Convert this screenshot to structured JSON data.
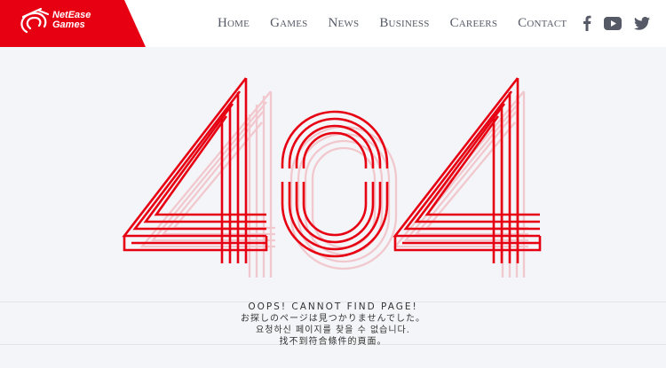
{
  "brand": {
    "name_line1": "NetEase",
    "name_line2": "Games",
    "color": "#e60012"
  },
  "nav": {
    "items": [
      {
        "label": "Home"
      },
      {
        "label": "Games"
      },
      {
        "label": "News"
      },
      {
        "label": "Business"
      },
      {
        "label": "Careers"
      },
      {
        "label": "Contact"
      }
    ]
  },
  "social": {
    "icons": [
      "facebook-icon",
      "youtube-icon",
      "twitter-icon"
    ]
  },
  "error": {
    "code": "404",
    "message_en": "OOPS! CANNOT FIND PAGE!",
    "message_ja": "お探しのページは見つかりませんでした。",
    "message_ko": "요청하신 페이지를 찾을 수 없습니다.",
    "message_zh": "找不到符合條件的頁面。"
  }
}
